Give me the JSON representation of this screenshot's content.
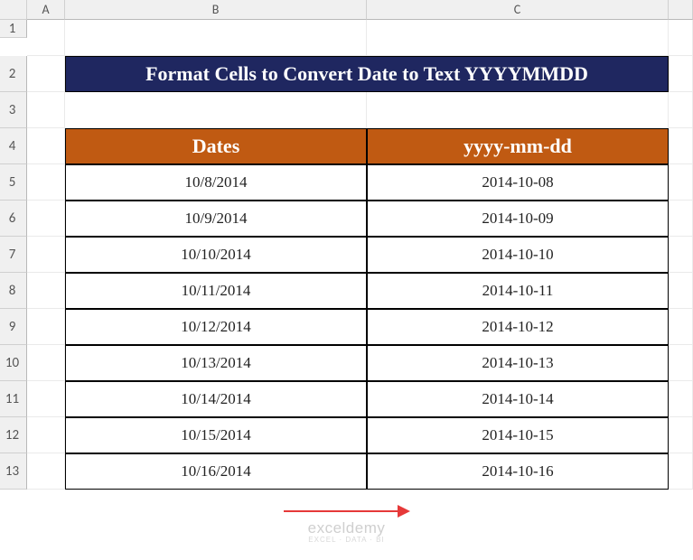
{
  "columns": [
    "A",
    "B",
    "C"
  ],
  "rows": [
    "1",
    "2",
    "3",
    "4",
    "5",
    "6",
    "7",
    "8",
    "9",
    "10",
    "11",
    "12",
    "13"
  ],
  "title": "Format Cells to Convert Date to Text YYYYMMDD",
  "headers": {
    "B": "Dates",
    "C": "yyyy-mm-dd"
  },
  "data": [
    {
      "B": "10/8/2014",
      "C": "2014-10-08"
    },
    {
      "B": "10/9/2014",
      "C": "2014-10-09"
    },
    {
      "B": "10/10/2014",
      "C": "2014-10-10"
    },
    {
      "B": "10/11/2014",
      "C": "2014-10-11"
    },
    {
      "B": "10/12/2014",
      "C": "2014-10-12"
    },
    {
      "B": "10/13/2014",
      "C": "2014-10-13"
    },
    {
      "B": "10/14/2014",
      "C": "2014-10-14"
    },
    {
      "B": "10/15/2014",
      "C": "2014-10-15"
    },
    {
      "B": "10/16/2014",
      "C": "2014-10-16"
    }
  ],
  "watermark": {
    "text": "exceldemy",
    "sub": "EXCEL · DATA · BI"
  }
}
